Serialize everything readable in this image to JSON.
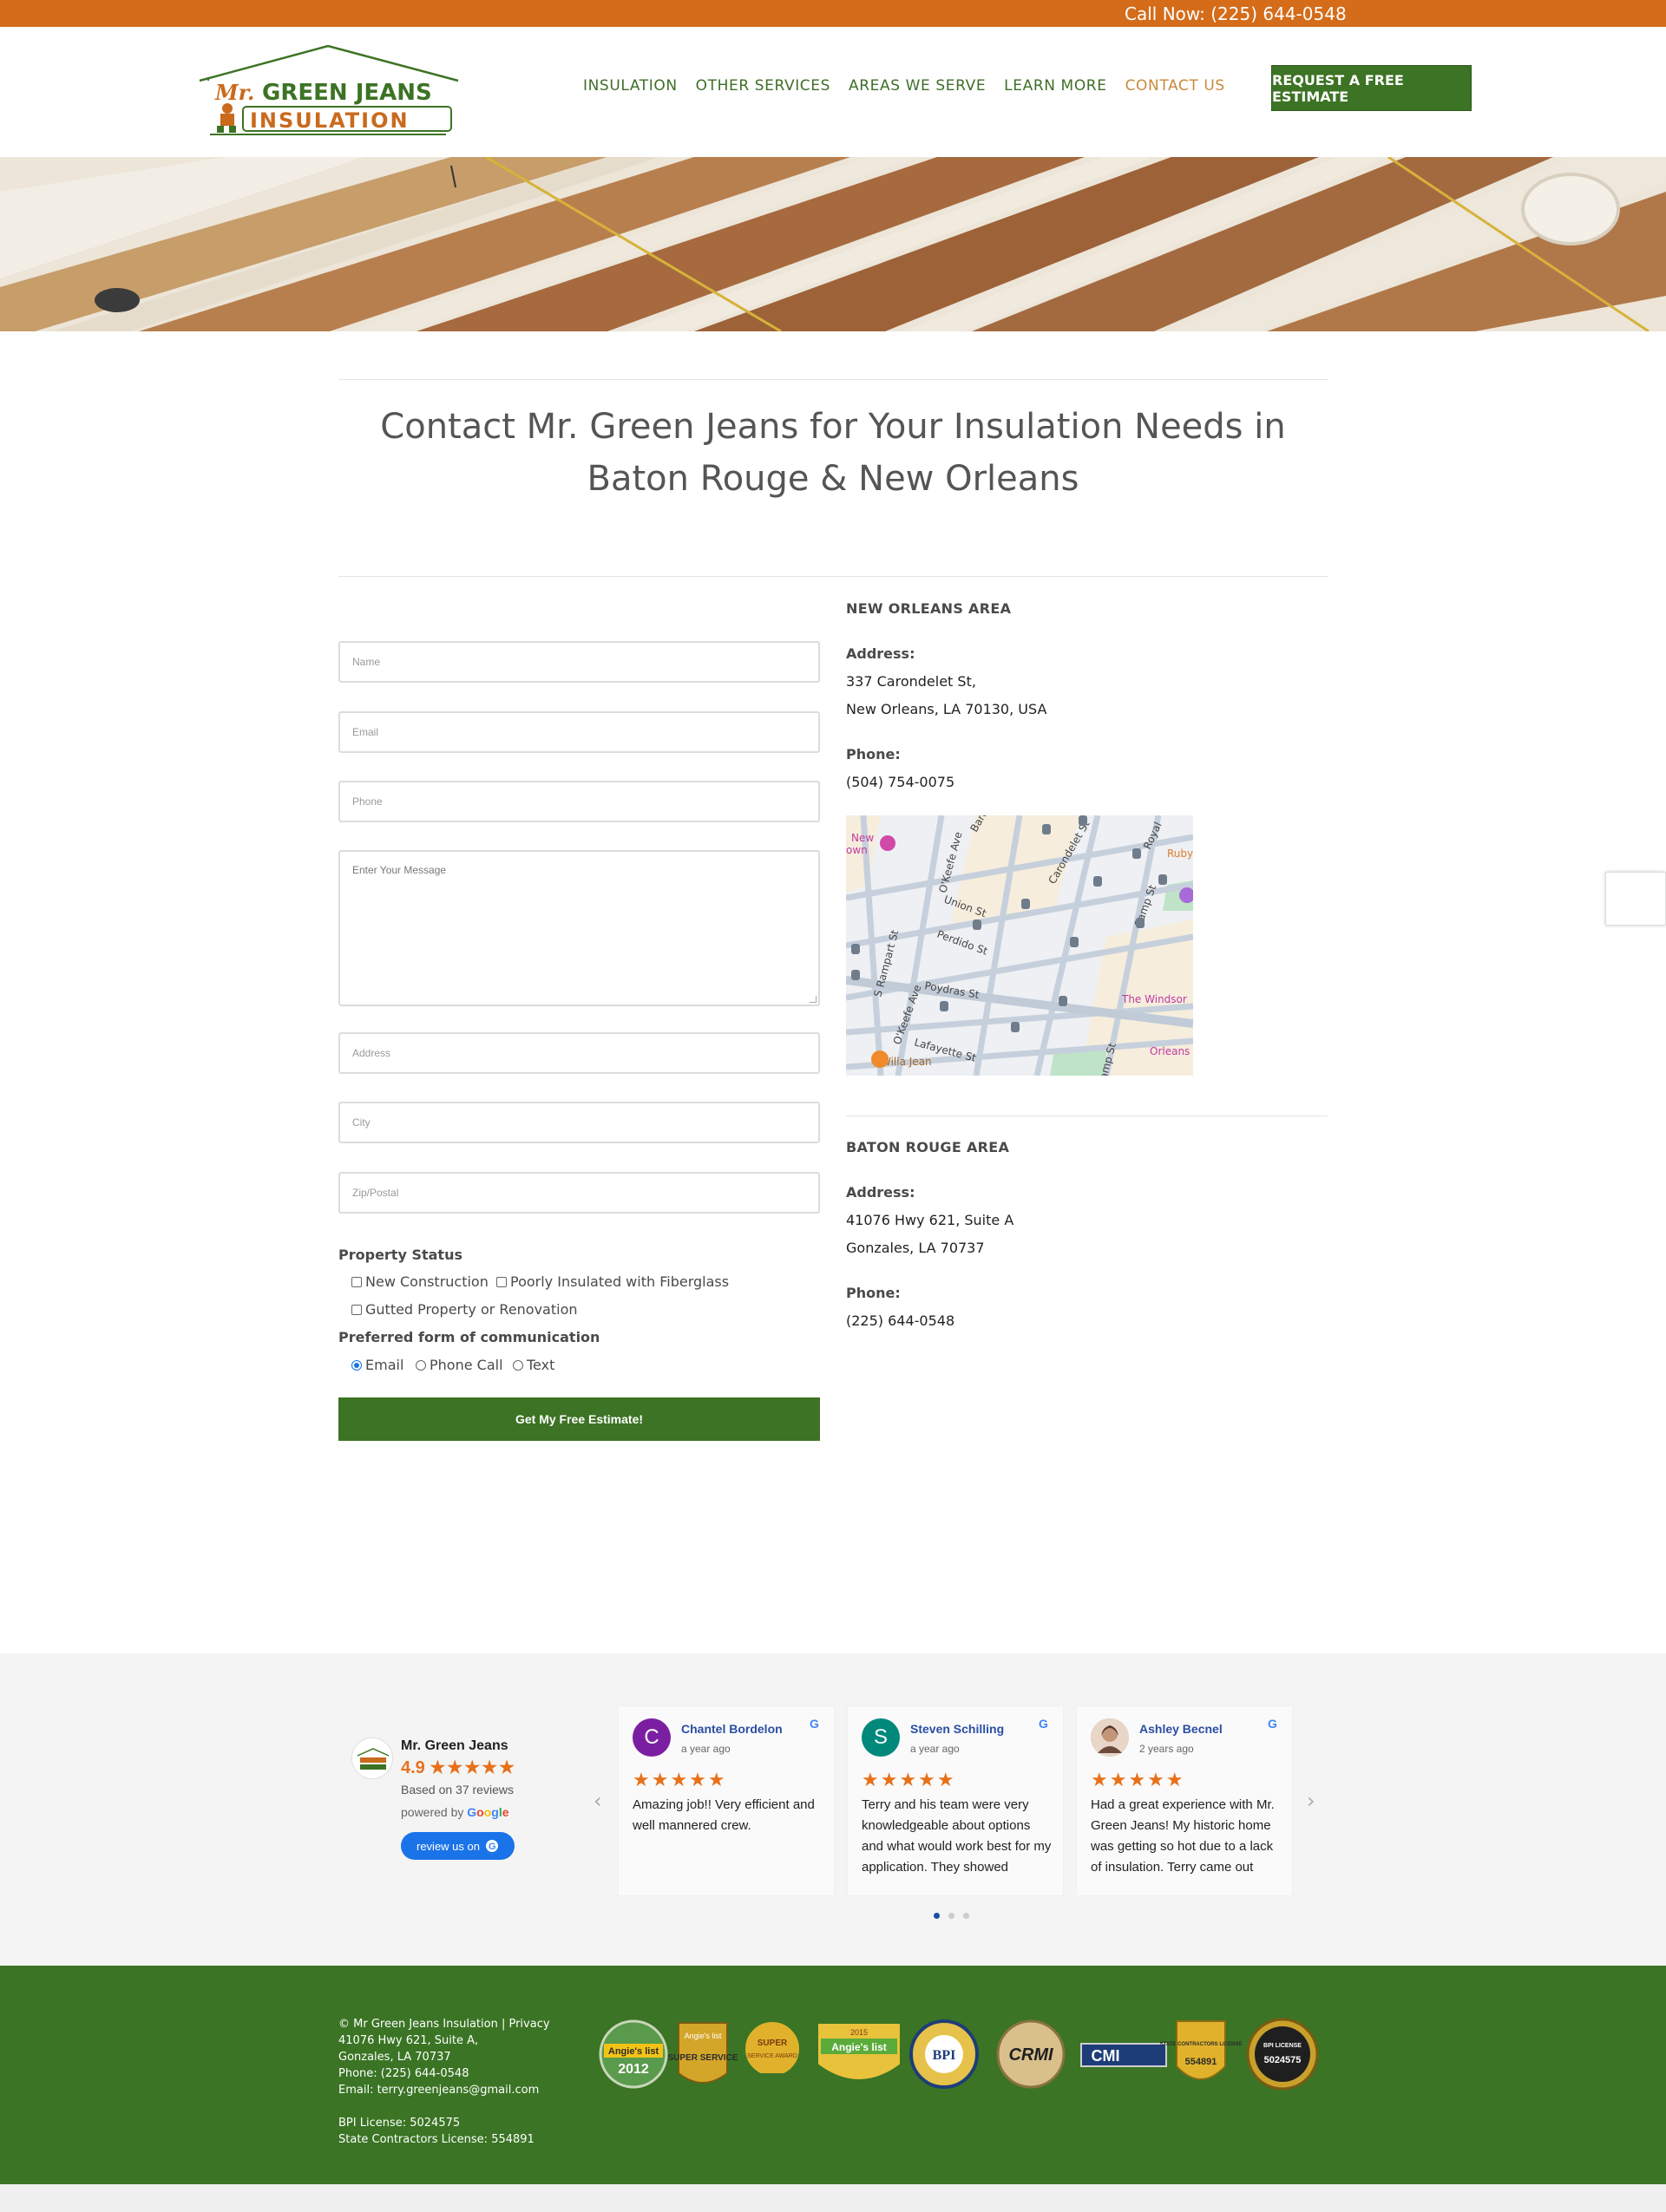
{
  "topbar": {
    "call_text": "Call Now: (225) 644-0548"
  },
  "logo": {
    "line1_a": "Mr.",
    "line1_b": "GREEN JEANS",
    "line2": "INSULATION"
  },
  "nav": {
    "items": [
      "INSULATION",
      "OTHER SERVICES",
      "AREAS WE SERVE",
      "LEARN MORE",
      "CONTACT US"
    ],
    "active_index": 4,
    "cta": "REQUEST A FREE ESTIMATE"
  },
  "page": {
    "title_line1": "Contact Mr. Green Jeans for Your Insulation Needs in",
    "title_line2": "Baton Rouge & New Orleans"
  },
  "form": {
    "placeholders": {
      "name": "Name",
      "email": "Email",
      "phone": "Phone",
      "message": "Enter Your Message",
      "address": "Address",
      "city": "City",
      "zip": "Zip/Postal"
    },
    "property_status_label": "Property Status",
    "property_options": [
      "New Construction",
      "Poorly Insulated with Fiberglass",
      "Gutted Property or Renovation"
    ],
    "communication_label": "Preferred form of communication",
    "communication_options": [
      "Email",
      "Phone Call",
      "Text"
    ],
    "communication_selected": "Email",
    "submit": "Get My Free Estimate!"
  },
  "locations": {
    "new_orleans": {
      "heading": "NEW ORLEANS AREA",
      "address_label": "Address:",
      "address_line1": "337 Carondelet St,",
      "address_line2": "New Orleans, LA 70130, USA",
      "phone_label": "Phone:",
      "phone": "(504) 754-0075"
    },
    "baton_rouge": {
      "heading": "BATON ROUGE AREA",
      "address_label": "Address:",
      "address_line1": "41076 Hwy 621, Suite A",
      "address_line2": "Gonzales, LA 70737",
      "phone_label": "Phone:",
      "phone": "(225) 644-0548"
    }
  },
  "map": {
    "streets": [
      "Baronne",
      "Carondelet St",
      "Royal",
      "O'Keefe Ave",
      "Union St",
      "Camp St",
      "Perdido St",
      "S Rampart St",
      "Poydras St",
      "O'Keefe Ave",
      "Lafayette St",
      "amp St"
    ],
    "places": [
      "New",
      "own",
      "Ruby",
      "The Windsor",
      "Orleans",
      "Willa Jean"
    ]
  },
  "reviews": {
    "business": "Mr. Green Jeans",
    "rating": "4.9",
    "rating_value": 4.9,
    "based_on": "Based on 37 reviews",
    "powered_prefix": "powered by",
    "powered_brand": "Google",
    "button": "review us on",
    "items": [
      {
        "initial": "C",
        "name": "Chantel Bordelon",
        "date": "a year ago",
        "stars": 5,
        "text": "Amazing job!! Very efficient and well mannered crew.",
        "avatar_color": "#7b1fa2"
      },
      {
        "initial": "S",
        "name": "Steven Schilling",
        "date": "a year ago",
        "stars": 5,
        "text": "Terry and his team were very knowledgeable about options and what would work best for my application. They showed",
        "avatar_color": "#00897b"
      },
      {
        "initial": "",
        "name": "Ashley Becnel",
        "date": "2 years ago",
        "stars": 5,
        "text": "Had a great experience with Mr. Green Jeans! My historic home was getting so hot due to a lack of insulation. Terry came out",
        "avatar_color": "#c9a58c"
      }
    ],
    "pagination": {
      "pages": 3,
      "current": 1
    }
  },
  "footer": {
    "line1": "© Mr Green Jeans Insulation | Privacy",
    "line2": "41076 Hwy 621, Suite A,",
    "line3": "Gonzales, LA 70737",
    "line4": "Phone: (225) 644-0548",
    "line5": "Email: terry.greenjeans@gmail.com",
    "line6": "BPI License: 5024575",
    "line7": "State Contractors License: 554891",
    "badges": [
      {
        "name": "angies-list-2012",
        "text_top": "Angie's list",
        "text_main": "2012"
      },
      {
        "name": "angies-list-2013-super-service",
        "text_top": "Angie's list",
        "text_main": "SUPER SERVICE"
      },
      {
        "name": "super-service-award",
        "text_top": "SUPER",
        "text_main": "SERVICE AWARD"
      },
      {
        "name": "angies-list-2015",
        "text_top": "2015",
        "text_main": "Angie's list"
      },
      {
        "name": "bpi-badge",
        "text_top": "",
        "text_main": "BPI"
      },
      {
        "name": "crmi-badge",
        "text_top": "",
        "text_main": "CRMI"
      },
      {
        "name": "cmi-badge",
        "text_top": "",
        "text_main": "CMI"
      },
      {
        "name": "state-contractors-license",
        "text_top": "STATE CONTRACTORS LICENSE",
        "text_main": "554891"
      },
      {
        "name": "bpi-license",
        "text_top": "BPI LICENSE",
        "text_main": "5024575"
      }
    ]
  },
  "colors": {
    "topbar": "#d46c1a",
    "brand_green": "#3d7324",
    "footer_green": "#3a7424",
    "nav_text": "#3f6e28",
    "nav_active": "#c98a3c",
    "star": "#e7711b"
  }
}
